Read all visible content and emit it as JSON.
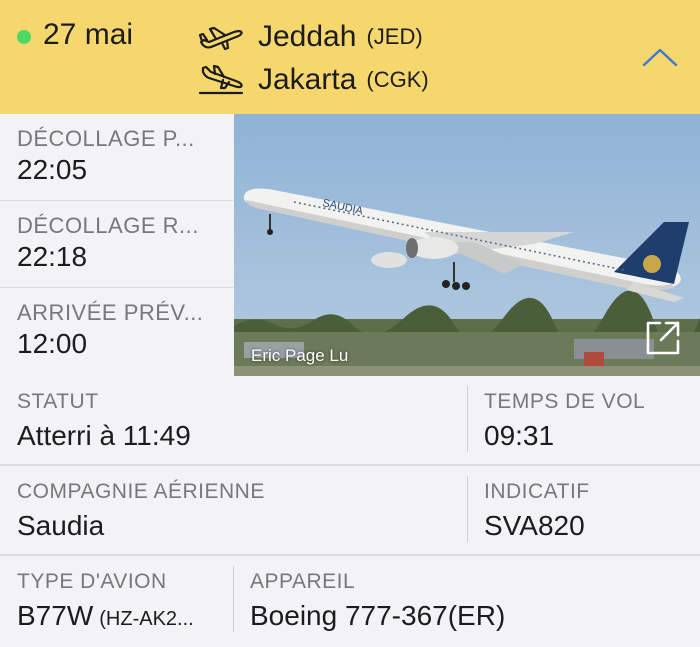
{
  "header": {
    "status_color": "#4cd964",
    "date": "27 mai",
    "departure": {
      "city": "Jeddah",
      "code": "(JED)",
      "icon": "plane-takeoff-icon"
    },
    "arrival": {
      "city": "Jakarta",
      "code": "(CGK)",
      "icon": "plane-landing-icon"
    },
    "collapse_icon": "chevron-up-icon",
    "background": "#f5d76e"
  },
  "times": [
    {
      "label": "DÉCOLLAGE P...",
      "value": "22:05"
    },
    {
      "label": "DÉCOLLAGE R...",
      "value": "22:18"
    },
    {
      "label": "ARRIVÉE PRÉV...",
      "value": "12:00"
    }
  ],
  "photo": {
    "credit": "Eric Page Lu",
    "expand_icon": "expand-icon"
  },
  "details": {
    "statut": {
      "label": "STATUT",
      "value": "Atterri à 11:49"
    },
    "temps_de_vol": {
      "label": "TEMPS DE VOL",
      "value": "09:31"
    },
    "compagnie": {
      "label": "COMPAGNIE AÉRIENNE",
      "value": "Saudia"
    },
    "indicatif": {
      "label": "INDICATIF",
      "value": "SVA820"
    },
    "type_avion": {
      "label": "TYPE D'AVION",
      "value": "B77W",
      "sub": "(HZ-AK2..."
    },
    "appareil": {
      "label": "APPAREIL",
      "value": "Boeing 777-367(ER)"
    }
  }
}
